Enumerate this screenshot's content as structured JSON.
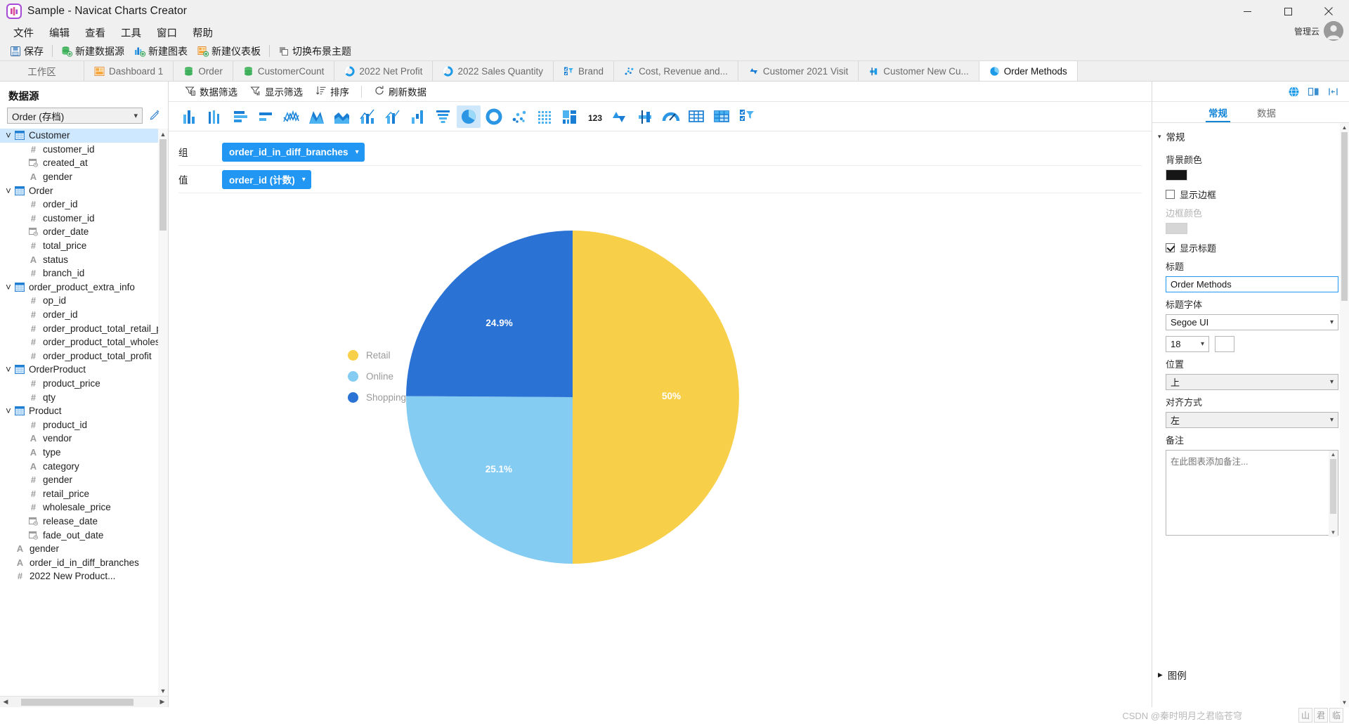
{
  "window": {
    "title": "Sample - Navicat Charts Creator",
    "app_icon": "navicat-charts-icon",
    "minimize": "minimize-icon",
    "maximize": "maximize-icon",
    "close": "close-icon"
  },
  "menubar": {
    "items": [
      {
        "label": "文件"
      },
      {
        "label": "编辑"
      },
      {
        "label": "查看"
      },
      {
        "label": "工具"
      },
      {
        "label": "窗口"
      },
      {
        "label": "帮助"
      }
    ]
  },
  "account": {
    "label": "管理云",
    "avatar": "user-avatar"
  },
  "toolbar": {
    "items": [
      {
        "label": "保存",
        "icon": "save-icon"
      },
      {
        "label": "新建数据源",
        "icon": "new-datasource-icon"
      },
      {
        "label": "新建图表",
        "icon": "new-chart-icon"
      },
      {
        "label": "新建仪表板",
        "icon": "new-dashboard-icon"
      },
      {
        "label": "切换布景主题",
        "icon": "switch-theme-icon"
      }
    ]
  },
  "tabs": [
    {
      "label": "工作区",
      "icon": "none",
      "active": false
    },
    {
      "label": "Dashboard 1",
      "icon": "dashboard-icon",
      "active": false
    },
    {
      "label": "Order",
      "icon": "datasource-icon",
      "active": false
    },
    {
      "label": "CustomerCount",
      "icon": "datasource-icon",
      "active": false
    },
    {
      "label": "2022 Net Profit",
      "icon": "donut-chart-icon",
      "active": false
    },
    {
      "label": "2022 Sales Quantity",
      "icon": "donut-chart-icon",
      "active": false
    },
    {
      "label": "Brand",
      "icon": "control-list-icon",
      "active": false
    },
    {
      "label": "Cost, Revenue and...",
      "icon": "scatter-chart-icon",
      "active": false
    },
    {
      "label": "Customer 2021 Visit",
      "icon": "value-chart-icon",
      "active": false
    },
    {
      "label": "Customer New Cu...",
      "icon": "bullet-chart-icon",
      "active": false
    },
    {
      "label": "Order Methods",
      "icon": "pie-chart-icon",
      "active": true
    }
  ],
  "sidebar": {
    "heading": "数据源",
    "source_value": "Order (存档)",
    "edit_icon": "pencil-icon",
    "tree": [
      {
        "type": "table",
        "label": "Customer",
        "expanded": true,
        "selected": true
      },
      {
        "type": "field",
        "glyph": "#",
        "label": "customer_id"
      },
      {
        "type": "field",
        "glyph": "date",
        "label": "created_at"
      },
      {
        "type": "field",
        "glyph": "A",
        "label": "gender"
      },
      {
        "type": "table",
        "label": "Order",
        "expanded": true,
        "selected": false
      },
      {
        "type": "field",
        "glyph": "#",
        "label": "order_id"
      },
      {
        "type": "field",
        "glyph": "#",
        "label": "customer_id"
      },
      {
        "type": "field",
        "glyph": "date",
        "label": "order_date"
      },
      {
        "type": "field",
        "glyph": "#",
        "label": "total_price"
      },
      {
        "type": "field",
        "glyph": "A",
        "label": "status"
      },
      {
        "type": "field",
        "glyph": "#",
        "label": "branch_id"
      },
      {
        "type": "table",
        "label": "order_product_extra_info",
        "expanded": true,
        "selected": false
      },
      {
        "type": "field",
        "glyph": "#",
        "label": "op_id"
      },
      {
        "type": "field",
        "glyph": "#",
        "label": "order_id"
      },
      {
        "type": "field",
        "glyph": "#",
        "label": "order_product_total_retail_p"
      },
      {
        "type": "field",
        "glyph": "#",
        "label": "order_product_total_wholes"
      },
      {
        "type": "field",
        "glyph": "#",
        "label": "order_product_total_profit"
      },
      {
        "type": "table",
        "label": "OrderProduct",
        "expanded": true,
        "selected": false
      },
      {
        "type": "field",
        "glyph": "#",
        "label": "product_price"
      },
      {
        "type": "field",
        "glyph": "#",
        "label": "qty"
      },
      {
        "type": "table",
        "label": "Product",
        "expanded": true,
        "selected": false
      },
      {
        "type": "field",
        "glyph": "#",
        "label": "product_id"
      },
      {
        "type": "field",
        "glyph": "A",
        "label": "vendor"
      },
      {
        "type": "field",
        "glyph": "A",
        "label": "type"
      },
      {
        "type": "field",
        "glyph": "A",
        "label": "category"
      },
      {
        "type": "field",
        "glyph": "#",
        "label": "gender"
      },
      {
        "type": "field",
        "glyph": "#",
        "label": "retail_price"
      },
      {
        "type": "field",
        "glyph": "#",
        "label": "wholesale_price"
      },
      {
        "type": "field",
        "glyph": "date",
        "label": "release_date"
      },
      {
        "type": "field",
        "glyph": "date",
        "label": "fade_out_date"
      },
      {
        "type": "root",
        "glyph": "A",
        "label": "gender"
      },
      {
        "type": "root",
        "glyph": "A",
        "label": "order_id_in_diff_branches"
      },
      {
        "type": "root",
        "glyph": "#",
        "label": "2022 New Product..."
      }
    ]
  },
  "chart_toolbar": {
    "items": [
      {
        "label": "数据筛选",
        "icon": "data-filter-icon"
      },
      {
        "label": "显示筛选",
        "icon": "display-filter-icon"
      },
      {
        "label": "排序",
        "icon": "sort-icon"
      },
      {
        "label": "刷新数据",
        "icon": "refresh-icon"
      }
    ]
  },
  "chart_types": [
    {
      "name": "column-chart-icon",
      "active": false
    },
    {
      "name": "column-stacked-icon",
      "active": false
    },
    {
      "name": "bar-chart-icon",
      "active": false
    },
    {
      "name": "bar-stacked-icon",
      "active": false
    },
    {
      "name": "line-chart-icon",
      "active": false
    },
    {
      "name": "area-chart-icon",
      "active": false
    },
    {
      "name": "stacked-area-icon",
      "active": false
    },
    {
      "name": "combo-line-column-icon",
      "active": false
    },
    {
      "name": "combo-chart-icon",
      "active": false
    },
    {
      "name": "waterfall-chart-icon",
      "active": false
    },
    {
      "name": "funnel-chart-icon",
      "active": false
    },
    {
      "name": "pie-chart-icon",
      "active": true
    },
    {
      "name": "donut-chart-icon",
      "active": false
    },
    {
      "name": "scatter-chart-icon",
      "active": false
    },
    {
      "name": "heatmap-icon",
      "active": false
    },
    {
      "name": "treemap-icon",
      "active": false
    },
    {
      "name": "value-123-icon",
      "active": false
    },
    {
      "name": "kpi-icon",
      "active": false
    },
    {
      "name": "bullet-chart-icon",
      "active": false
    },
    {
      "name": "gauge-chart-icon",
      "active": false
    },
    {
      "name": "table-icon",
      "active": false
    },
    {
      "name": "pivot-table-icon",
      "active": false
    },
    {
      "name": "control-list-icon",
      "active": false
    }
  ],
  "shelves": [
    {
      "label": "组",
      "pill": "order_id_in_diff_branches",
      "chevron": "chevron-down-icon"
    },
    {
      "label": "值",
      "pill": "order_id (计数)",
      "chevron": "chevron-down-icon"
    }
  ],
  "properties": {
    "tabs": [
      {
        "label": "常规",
        "active": true
      },
      {
        "label": "数据",
        "active": false
      }
    ],
    "section_general": "常规",
    "section_legend": "图例",
    "bg_color_label": "背景颜色",
    "bg_color_value": "#161616",
    "show_border_label": "显示边框",
    "show_border_checked": false,
    "border_color_label": "边框颜色",
    "border_color_value": "#d6d6d6",
    "show_title_label": "显示标题",
    "show_title_checked": true,
    "title_label": "标题",
    "title_value": "Order Methods",
    "title_font_label": "标题字体",
    "title_font_value": "Segoe UI",
    "title_font_size": "18",
    "title_font_color": "#ffffff",
    "position_label": "位置",
    "position_value": "上",
    "align_label": "对齐方式",
    "align_value": "左",
    "note_label": "备注",
    "note_placeholder": "在此图表添加备注..."
  },
  "chart_data": {
    "type": "pie",
    "title": "Order Methods",
    "categories": [
      "Retail",
      "Online",
      "Shopping Mall"
    ],
    "values": [
      50,
      25.1,
      24.9
    ],
    "labels": [
      "50%",
      "25.1%",
      "24.9%"
    ],
    "colors": [
      "#f8cf48",
      "#85ccf2",
      "#2a72d4"
    ],
    "legend_position": "left",
    "legend_entries": [
      {
        "label": "Retail",
        "color": "#f8cf48"
      },
      {
        "label": "Online",
        "color": "#85ccf2"
      },
      {
        "label": "Shopping Mall",
        "color": "#2a72d4"
      }
    ],
    "grid": false,
    "group_field": "order_id_in_diff_branches",
    "value_field": "order_id (计数)"
  },
  "watermark": {
    "text": "CSDN @秦时明月之君临苍穹",
    "badges": [
      "山",
      "君",
      "临"
    ]
  }
}
